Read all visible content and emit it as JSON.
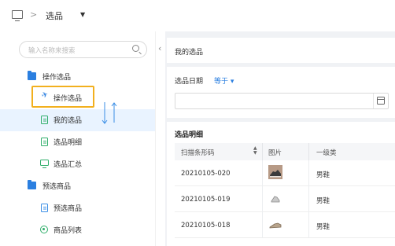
{
  "topbar": {
    "title": "选品",
    "separator": ">"
  },
  "search": {
    "placeholder": "输入名称来搜索"
  },
  "sidebar": {
    "items": [
      {
        "label": "操作选品"
      },
      {
        "label": "操作选品"
      },
      {
        "label": "我的选品"
      },
      {
        "label": "选品明细"
      },
      {
        "label": "选品汇总"
      },
      {
        "label": "预选商品"
      },
      {
        "label": "预选商品"
      },
      {
        "label": "商品列表"
      }
    ]
  },
  "main": {
    "header_title": "我的选品",
    "filter": {
      "label": "选品日期",
      "operator": "等于 ▾"
    },
    "detail": {
      "title": "选品明细",
      "columns": [
        "扫描条形码",
        "图片",
        "一级类"
      ],
      "rows": [
        {
          "barcode": "20210105-020",
          "category": "男鞋"
        },
        {
          "barcode": "20210105-019",
          "category": "男鞋"
        },
        {
          "barcode": "20210105-018",
          "category": "男鞋"
        }
      ]
    }
  },
  "colors": {
    "accent": "#2b7fe0",
    "highlight": "#f2b01e",
    "active_bg": "#e9f3ff"
  }
}
